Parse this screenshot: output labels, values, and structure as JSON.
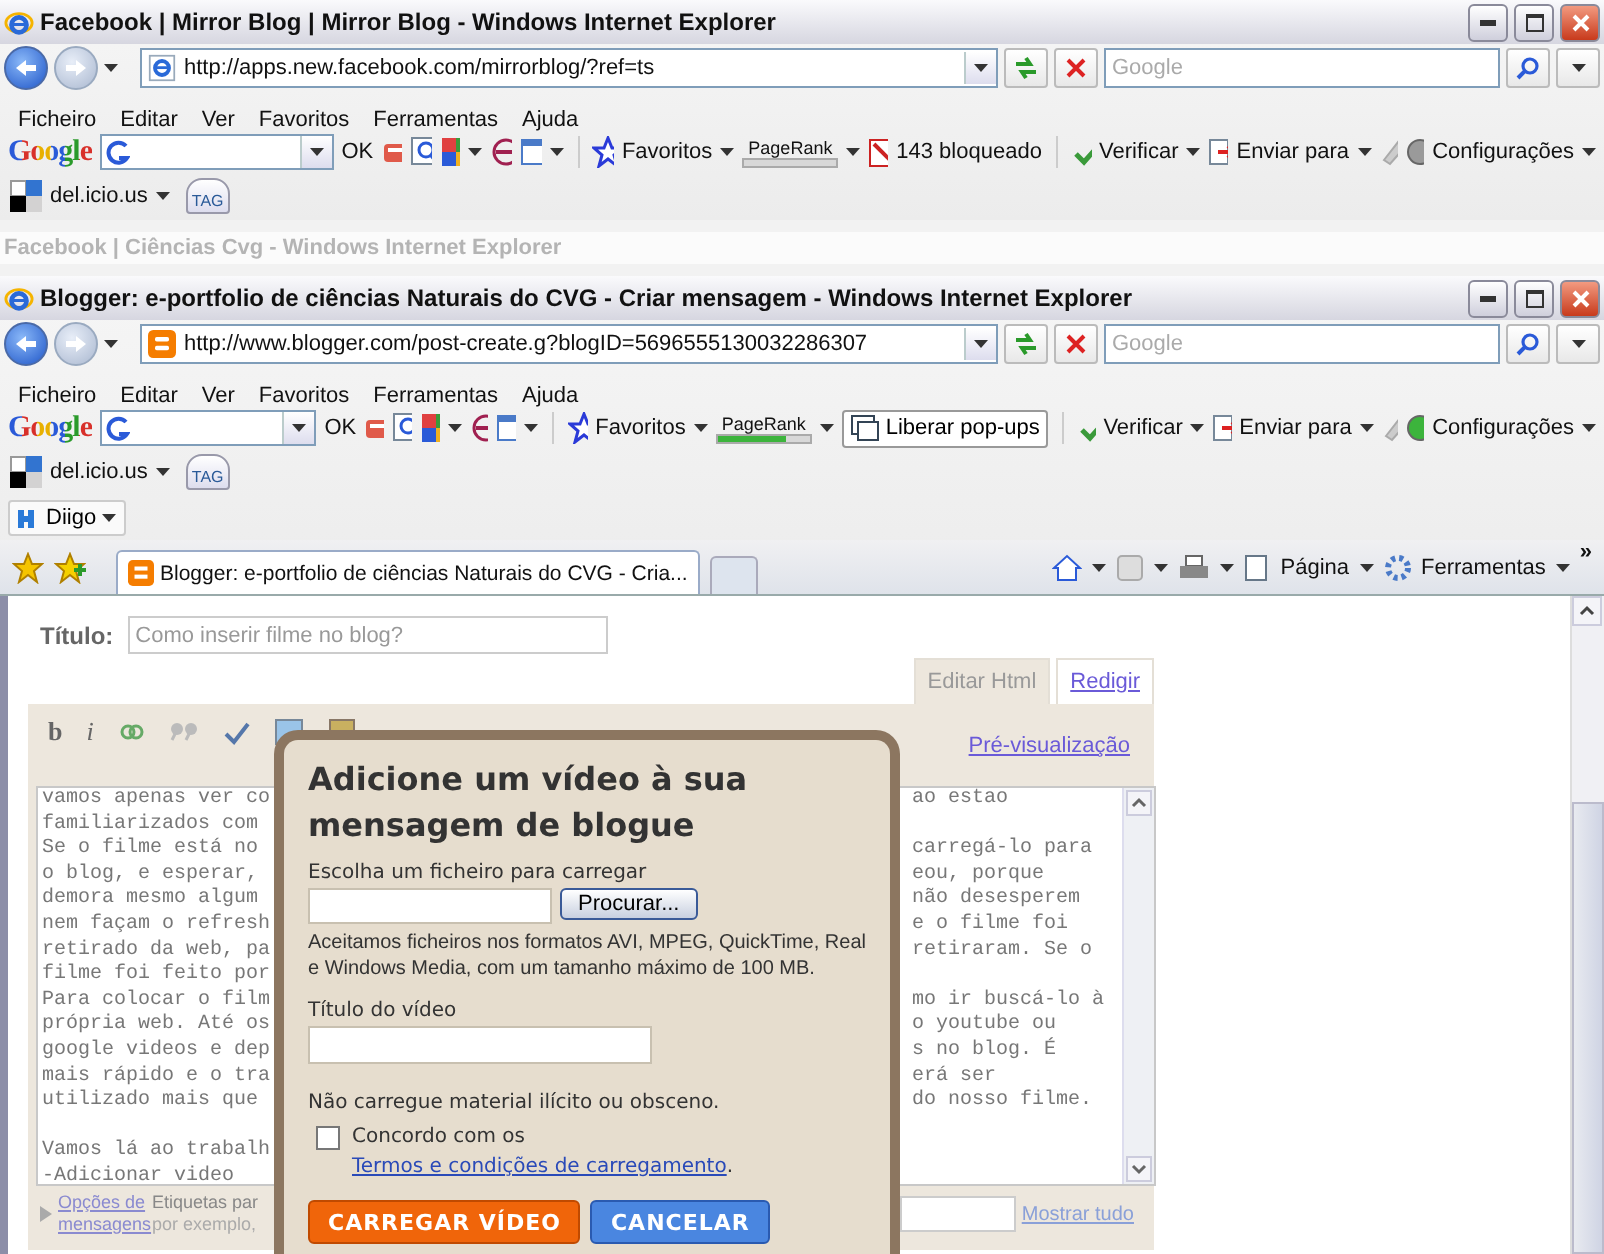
{
  "windows": [
    {
      "title": "Facebook | Mirror Blog | Mirror Blog - Windows Internet Explorer",
      "kind": "ie",
      "address": "http://apps.new.facebook.com/mirrorblog/?ref=ts",
      "search_placeholder": "Google",
      "menu": [
        "Ficheiro",
        "Editar",
        "Ver",
        "Favoritos",
        "Ferramentas",
        "Ajuda"
      ],
      "google_logo": "Google",
      "ok": "OK",
      "favorites": "Favoritos",
      "pagerank": {
        "label": "PageRank",
        "level": 0
      },
      "popup": {
        "kind": "blocked",
        "label": "143 bloqueado"
      },
      "spell": "Verificar",
      "send": "Enviar para",
      "settings": {
        "label": "Configurações",
        "on": false
      },
      "delicious": "del.icio.us",
      "tag": "TAG"
    },
    {
      "title": "Blogger: e-portfolio de ciências Naturais do CVG - Criar mensagem - Windows Internet Explorer",
      "kind": "blogger",
      "address": "http://www.blogger.com/post-create.g?blogID=5696555130032286307",
      "search_placeholder": "Google",
      "menu": [
        "Ficheiro",
        "Editar",
        "Ver",
        "Favoritos",
        "Ferramentas",
        "Ajuda"
      ],
      "google_logo": "Google",
      "ok": "OK",
      "favorites": "Favoritos",
      "pagerank": {
        "label": "PageRank",
        "level": 0.75
      },
      "popup": {
        "kind": "allow",
        "label": "Liberar pop-ups"
      },
      "spell": "Verificar",
      "send": "Enviar para",
      "settings": {
        "label": "Configurações",
        "on": true
      },
      "delicious": "del.icio.us",
      "tag": "TAG",
      "diigo": "Diigo",
      "tab": "Blogger: e-portfolio de ciências Naturais do CVG - Cria...",
      "command_bar": {
        "page": "Página",
        "tools": "Ferramentas",
        "more": "»"
      }
    }
  ],
  "background_window_title": "Facebook | Ciências Cvg - Windows Internet Explorer",
  "post": {
    "title_label": "Título:",
    "title_value": "Como inserir filme no blog?",
    "mode_tabs": [
      {
        "label": "Editar Html",
        "selected": true
      },
      {
        "label": "Redigir",
        "selected": false
      }
    ],
    "format_buttons": [
      "b",
      "i"
    ],
    "preview_link": "Pré-visualização",
    "editor_lines": [
      {
        "left": "vamos apenas ver co",
        "right": "ao estao"
      },
      {
        "left": "familiarizados com"
      },
      {
        "left": "Se o filme está no",
        "right": "carregá-lo para"
      },
      {
        "left": "o blog, e esperar,",
        "right": "eou, porque"
      },
      {
        "left": "demora mesmo algum",
        "right": "não desesperem"
      },
      {
        "left": "nem façam o refresh",
        "right": "e o filme foi"
      },
      {
        "left": "retirado da web, pa",
        "right": "retiraram. Se o"
      },
      {
        "left": "filme foi feito por"
      },
      {
        "left": "Para colocar o film",
        "right": "mo ir buscá-lo à"
      },
      {
        "left": "própria web. Até os",
        "right": "o youtube ou"
      },
      {
        "left": "google videos e dep",
        "right": "s no blog. É"
      },
      {
        "left": "mais rápido e o tra",
        "right": "erá ser"
      },
      {
        "left": "utilizado mais que",
        "right": "do nosso filme."
      },
      {
        "kind": "blank"
      },
      {
        "left": "Vamos lá ao trabalh"
      },
      {
        "left": "-Adicionar video"
      }
    ],
    "options_link": "Opções de mensagens",
    "labels_text": "Etiquetas par",
    "labels_hint": "por exemplo,",
    "show_all": "Mostrar tudo"
  },
  "dialog": {
    "title": "Adicione um vídeo à sua mensagem de blogue",
    "file_label": "Escolha um ficheiro para carregar",
    "browse": "Procurar...",
    "formats": "Aceitamos ficheiros nos formatos AVI, MPEG, QuickTime, Real e Windows Media, com um tamanho máximo de 100 MB.",
    "video_title_label": "Título do vídeo",
    "warning": "Não carregue material ilícito ou obsceno.",
    "terms": {
      "checked": false,
      "text": "Concordo com os",
      "link": "Termos e condições de carregamento",
      "after": "."
    },
    "upload": "CARREGAR VÍDEO",
    "cancel": "CANCELAR"
  }
}
